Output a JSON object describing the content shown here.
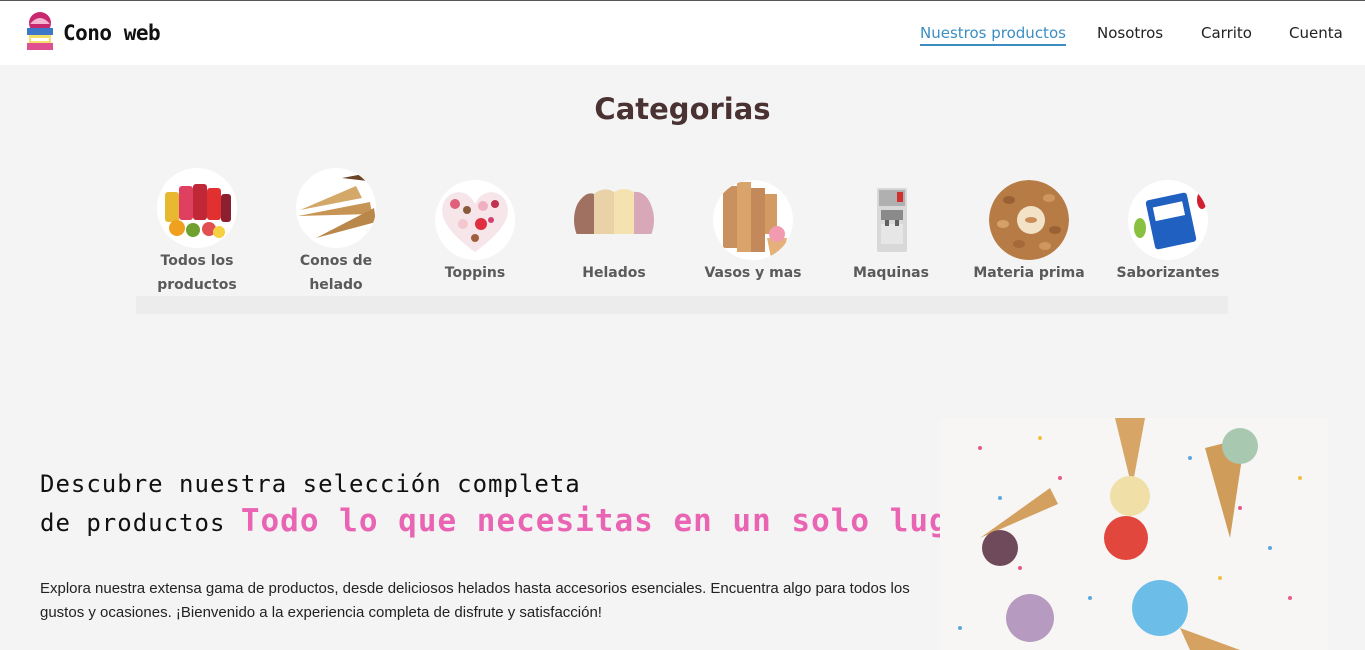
{
  "header": {
    "brand": "Cono web",
    "nav": [
      {
        "label": "Nuestros productos",
        "active": true
      },
      {
        "label": "Nosotros",
        "active": false
      },
      {
        "label": "Carrito",
        "active": false
      },
      {
        "label": "Cuenta",
        "active": false
      }
    ]
  },
  "categories": {
    "title": "Categorias",
    "items": [
      {
        "label": "Todos los productos",
        "icon": "ice-pops-image"
      },
      {
        "label": "Conos de helado",
        "icon": "waffle-cones-image"
      },
      {
        "label": "Toppins",
        "icon": "toppings-heart-image"
      },
      {
        "label": "Helados",
        "icon": "ice-cream-tubs-image"
      },
      {
        "label": "Vasos y mas",
        "icon": "paper-cups-image"
      },
      {
        "label": "Maquinas",
        "icon": "ice-cream-machine-image"
      },
      {
        "label": "Materia prima",
        "icon": "almonds-image"
      },
      {
        "label": "Saborizantes",
        "icon": "flavoring-packet-image"
      }
    ]
  },
  "hero": {
    "line1": "Descubre nuestra selección completa",
    "line2": "de productos",
    "highlight": "Todo lo que necesitas en un solo lugar",
    "description": "Explora nuestra extensa gama de productos, desde deliciosos helados hasta accesorios esenciales. Encuentra algo para todos los gustos y ocasiones. ¡Bienvenido a la experiencia completa de disfrute y satisfacción!",
    "image": "ice-cream-cones-sprinkles-image"
  },
  "colors": {
    "accent": "#3c8ec2",
    "pink": "#e964b3",
    "title": "#4a3132"
  }
}
